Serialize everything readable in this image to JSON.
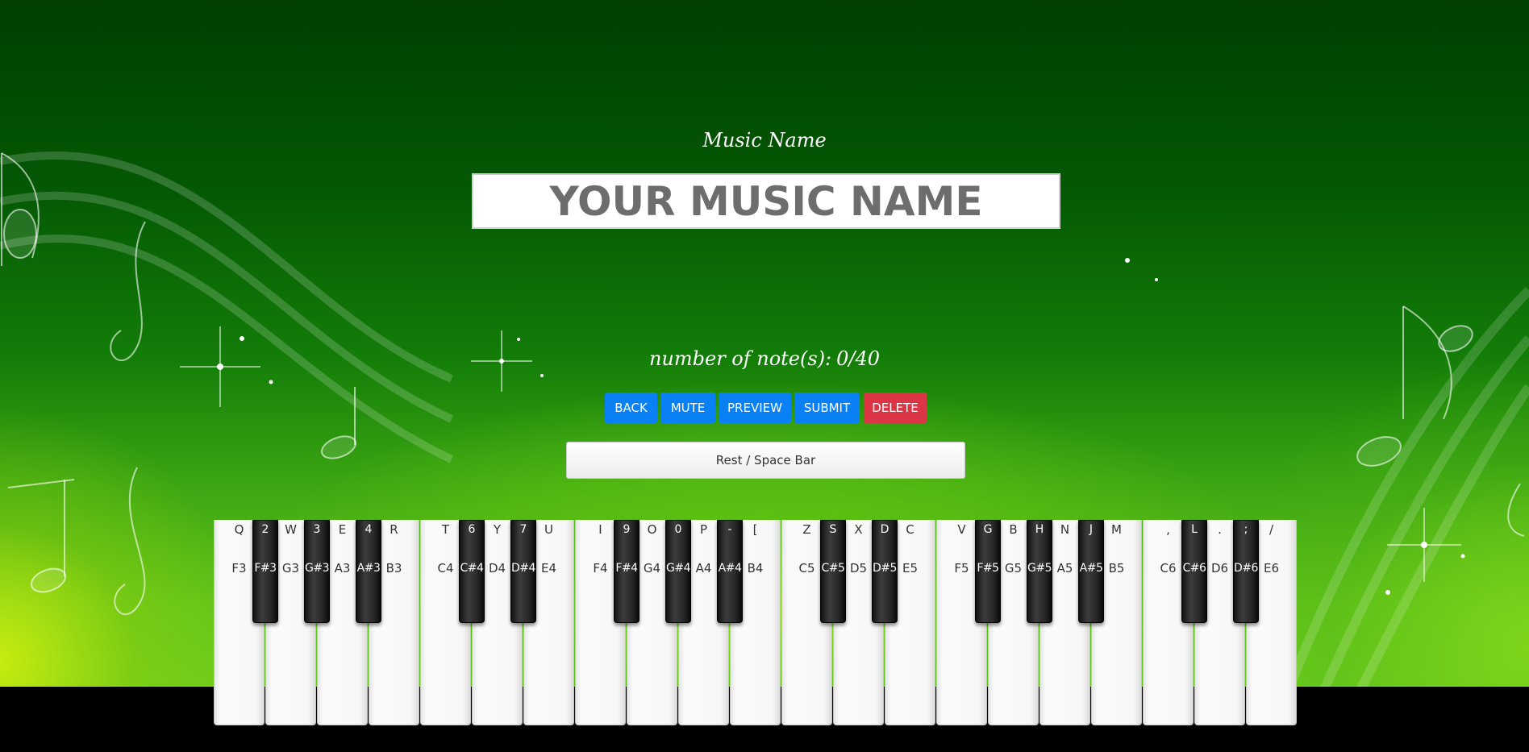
{
  "header": {
    "music_name_label": "Music Name",
    "name_input_placeholder": "YOUR MUSIC NAME"
  },
  "notes": {
    "label": "number of note(s):",
    "count": "0/40"
  },
  "buttons": {
    "back": "BACK",
    "mute": "MUTE",
    "preview": "PREVIEW",
    "submit": "SUBMIT",
    "delete": "DELETE"
  },
  "rest_button": "Rest / Space Bar",
  "keyboard": {
    "white_keys": [
      {
        "key": "Q",
        "note": "F3"
      },
      {
        "key": "W",
        "note": "G3"
      },
      {
        "key": "E",
        "note": "A3"
      },
      {
        "key": "R",
        "note": "B3"
      },
      {
        "key": "T",
        "note": "C4"
      },
      {
        "key": "Y",
        "note": "D4"
      },
      {
        "key": "U",
        "note": "E4"
      },
      {
        "key": "I",
        "note": "F4"
      },
      {
        "key": "O",
        "note": "G4"
      },
      {
        "key": "P",
        "note": "A4"
      },
      {
        "key": "[",
        "note": "B4"
      },
      {
        "key": "Z",
        "note": "C5"
      },
      {
        "key": "X",
        "note": "D5"
      },
      {
        "key": "C",
        "note": "E5"
      },
      {
        "key": "V",
        "note": "F5"
      },
      {
        "key": "B",
        "note": "G5"
      },
      {
        "key": "N",
        "note": "A5"
      },
      {
        "key": "M",
        "note": "B5"
      },
      {
        "key": ",",
        "note": "C6"
      },
      {
        "key": ".",
        "note": "D6"
      },
      {
        "key": "/",
        "note": "E6"
      }
    ],
    "black_keys": [
      {
        "key": "2",
        "note": "F#3"
      },
      {
        "key": "3",
        "note": "G#3"
      },
      {
        "key": "4",
        "note": "A#3"
      },
      {
        "key": "6",
        "note": "C#4"
      },
      {
        "key": "7",
        "note": "D#4"
      },
      {
        "key": "9",
        "note": "F#4"
      },
      {
        "key": "0",
        "note": "G#4"
      },
      {
        "key": "-",
        "note": "A#4"
      },
      {
        "key": "S",
        "note": "C#5"
      },
      {
        "key": "D",
        "note": "D#5"
      },
      {
        "key": "G",
        "note": "F#5"
      },
      {
        "key": "H",
        "note": "G#5"
      },
      {
        "key": "J",
        "note": "A#5"
      },
      {
        "key": "L",
        "note": "C#6"
      },
      {
        "key": ";",
        "note": "D#6"
      }
    ]
  },
  "colors": {
    "primary_button": "#0a80f5",
    "danger_button": "#dc3545",
    "background_top": "#003f00",
    "background_bottom": "#6ccb1c"
  }
}
